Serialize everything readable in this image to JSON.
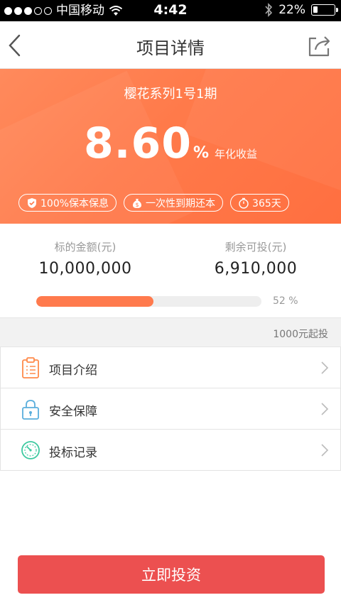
{
  "status_bar": {
    "carrier": "中国移动",
    "time": "4:42",
    "battery_percent": "22%",
    "battery_level": 0.22,
    "signal_dots_filled": 3,
    "signal_dots_total": 5
  },
  "nav": {
    "title": "项目详情",
    "back_icon": "chevron-left-icon",
    "share_icon": "share-icon"
  },
  "hero": {
    "product_name": "樱花系列1号1期",
    "rate_value": "8.60",
    "rate_unit": "%",
    "rate_label": "年化收益",
    "tags": [
      {
        "icon": "shield-icon",
        "label": "100%保本保息"
      },
      {
        "icon": "money-bag-icon",
        "label": "一次性到期还本"
      },
      {
        "icon": "stopwatch-icon",
        "label": "365天"
      }
    ]
  },
  "stats": {
    "target_label": "标的金额(元)",
    "target_value": "10,000,000",
    "remaining_label": "剩余可投(元)",
    "remaining_value": "6,910,000",
    "progress_percent": 52,
    "progress_text": "52 %",
    "min_invest": "1000元起投"
  },
  "menu": [
    {
      "icon": "clipboard-icon",
      "label": "项目介绍"
    },
    {
      "icon": "lock-icon",
      "label": "安全保障"
    },
    {
      "icon": "gauge-icon",
      "label": "投标记录"
    }
  ],
  "action": {
    "invest_label": "立即投资"
  },
  "colors": {
    "accent": "#ff7a4d",
    "button": "#ec5050",
    "clipboard_icon": "#ff8a4a",
    "lock_icon": "#5aaedc",
    "gauge_icon": "#3dc9a0"
  }
}
